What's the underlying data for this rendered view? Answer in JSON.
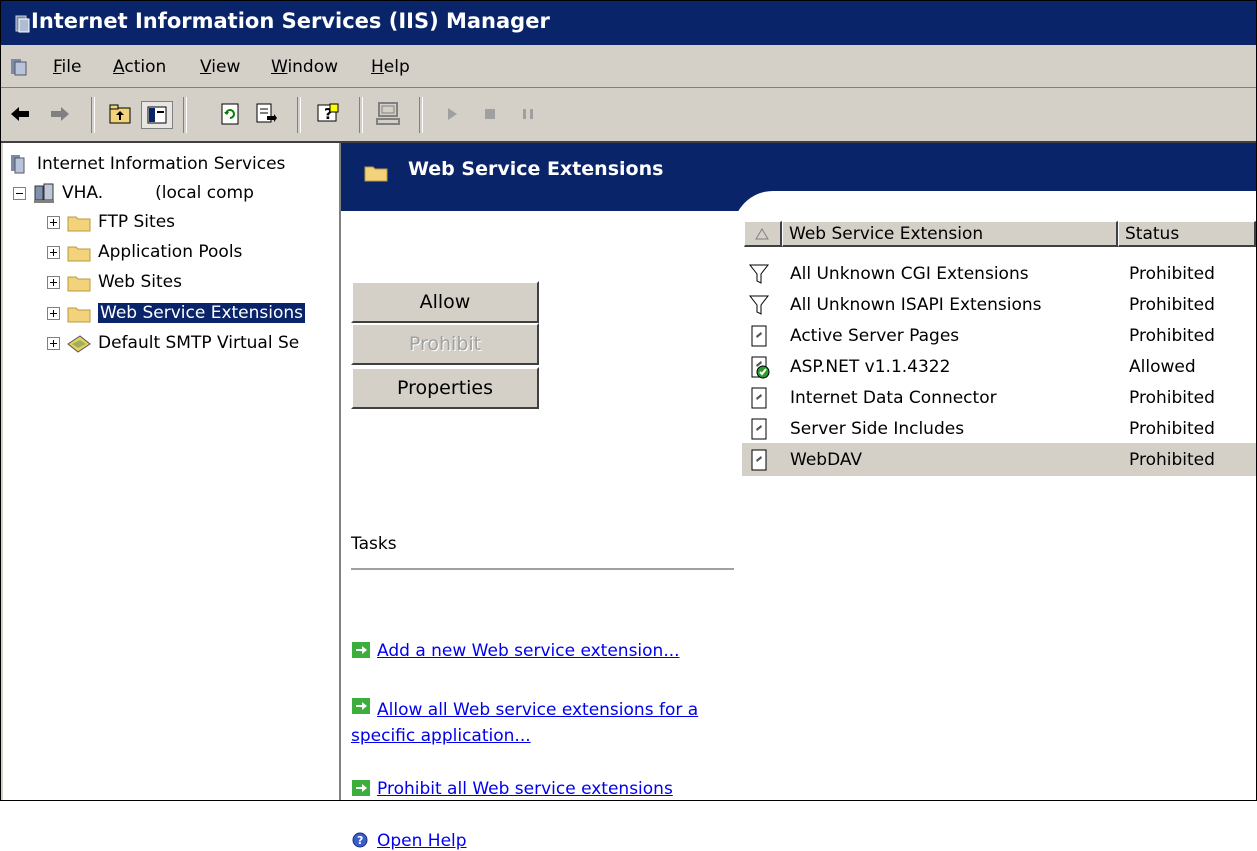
{
  "window": {
    "title": "Internet Information Services (IIS) Manager"
  },
  "menu": {
    "items": [
      "File",
      "Action",
      "View",
      "Window",
      "Help"
    ]
  },
  "toolbar": {
    "buttons": [
      "back-icon",
      "forward-icon",
      "up-folder-icon",
      "show-tree-icon",
      "refresh-icon",
      "export-icon",
      "help-icon",
      "computer-icon",
      "play-icon",
      "stop-icon",
      "pause-icon"
    ]
  },
  "tree": {
    "root": "Internet Information Services",
    "server": {
      "name": "VHA.",
      "suffix": "(local comp"
    },
    "children": [
      {
        "label": "FTP Sites"
      },
      {
        "label": "Application Pools"
      },
      {
        "label": "Web Sites"
      },
      {
        "label": "Web Service Extensions"
      },
      {
        "label": "Default SMTP Virtual Se"
      }
    ]
  },
  "content": {
    "header_title": "Web Service Extensions",
    "buttons": {
      "allow": "Allow",
      "prohibit": "Prohibit",
      "properties": "Properties"
    },
    "tasks_label": "Tasks",
    "tasks": [
      {
        "line1": "Add a new Web service extension...",
        "line2": ""
      },
      {
        "line1": "Allow all Web service extensions for a",
        "line2": "specific application..."
      },
      {
        "line1": "Prohibit all Web service extensions",
        "line2": ""
      },
      {
        "line1": "Open Help",
        "line2": ""
      }
    ]
  },
  "list": {
    "columns": [
      "Web Service Extension",
      "Status"
    ],
    "rows": [
      {
        "name": "All Unknown CGI Extensions",
        "status": "Prohibited",
        "icon": "filter-icon"
      },
      {
        "name": "All Unknown ISAPI Extensions",
        "status": "Prohibited",
        "icon": "filter-icon"
      },
      {
        "name": "Active Server Pages",
        "status": "Prohibited",
        "icon": "document-icon"
      },
      {
        "name": "ASP.NET v1.1.4322",
        "status": "Allowed",
        "icon": "allowed-document-icon"
      },
      {
        "name": "Internet Data Connector",
        "status": "Prohibited",
        "icon": "document-icon"
      },
      {
        "name": "Server Side Includes",
        "status": "Prohibited",
        "icon": "document-icon"
      },
      {
        "name": "WebDAV",
        "status": "Prohibited",
        "icon": "document-icon"
      }
    ]
  },
  "colors": {
    "titlebar": "#0a246a",
    "face": "#d4d0c8",
    "link": "#0000ee",
    "folder": "#f2d27a"
  }
}
